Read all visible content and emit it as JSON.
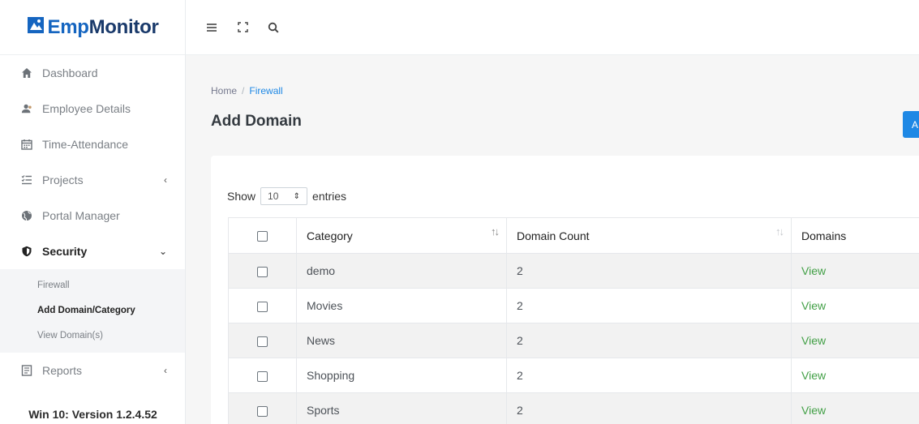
{
  "brand": {
    "emp": "Emp",
    "monitor": "Monitor"
  },
  "sidebar": {
    "items": [
      {
        "label": "Dashboard",
        "icon": "home-icon"
      },
      {
        "label": "Employee Details",
        "icon": "user-icon"
      },
      {
        "label": "Time-Attendance",
        "icon": "calendar-icon"
      },
      {
        "label": "Projects",
        "icon": "list-check-icon",
        "caret": "‹"
      },
      {
        "label": "Portal Manager",
        "icon": "globe-icon"
      },
      {
        "label": "Security",
        "icon": "shield-icon",
        "caret": "⌄"
      },
      {
        "label": "Reports",
        "icon": "report-icon",
        "caret": "‹"
      }
    ],
    "security_submenu": [
      "Firewall",
      "Add Domain/Category",
      "View Domain(s)"
    ],
    "version": "Win 10: Version 1.2.4.52"
  },
  "breadcrumb": {
    "home": "Home",
    "sep": "/",
    "current": "Firewall"
  },
  "page": {
    "title": "Add Domain",
    "button_label": "A"
  },
  "table_controls": {
    "show": "Show",
    "entries": "entries",
    "page_size": "10"
  },
  "table": {
    "columns": [
      "Category",
      "Domain Count",
      "Domains"
    ],
    "rows": [
      {
        "category": "demo",
        "count": "2",
        "domains": "View"
      },
      {
        "category": "Movies",
        "count": "2",
        "domains": "View"
      },
      {
        "category": "News",
        "count": "2",
        "domains": "View"
      },
      {
        "category": "Shopping",
        "count": "2",
        "domains": "View"
      },
      {
        "category": "Sports",
        "count": "2",
        "domains": "View"
      }
    ]
  },
  "colors": {
    "accent": "#1e88e5",
    "brand_dark": "#1a3a6b",
    "link_green": "#43a047"
  }
}
